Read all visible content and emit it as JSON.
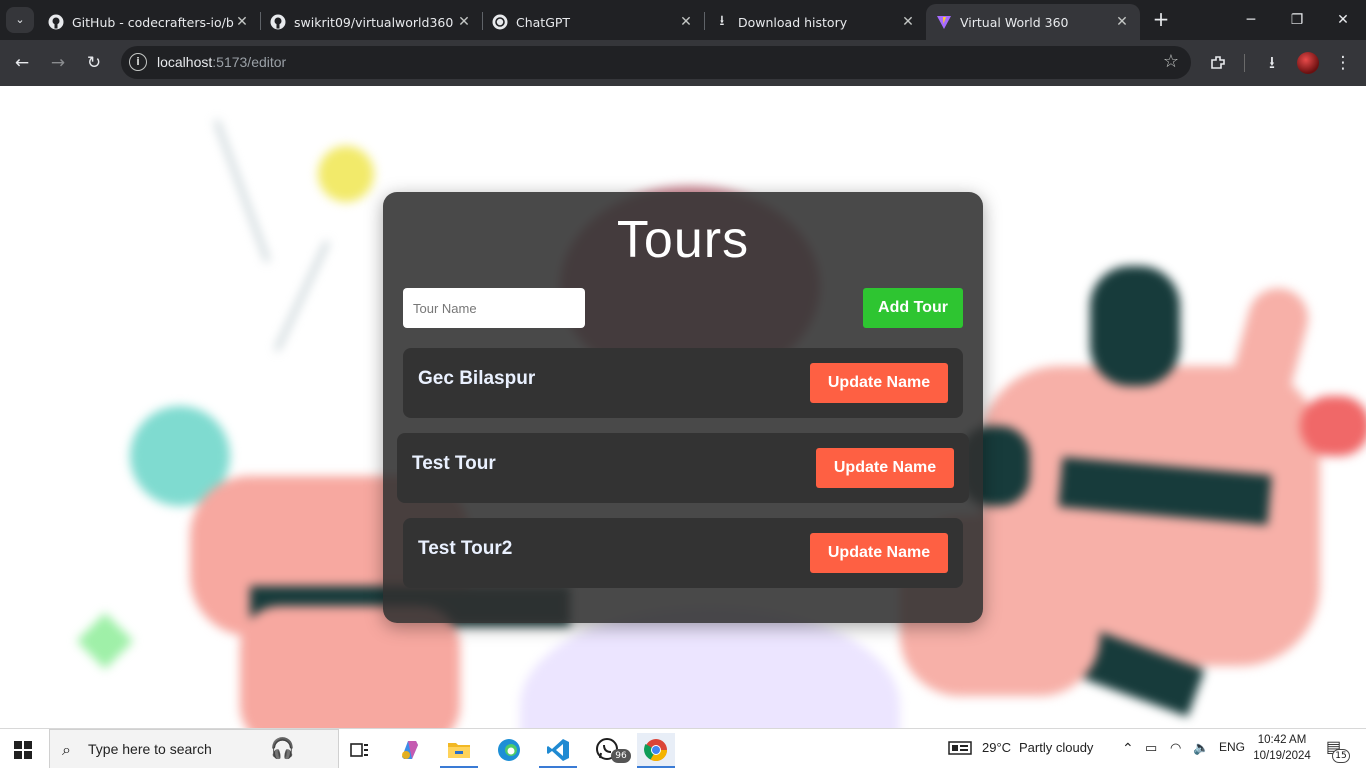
{
  "browser": {
    "tabs": [
      {
        "title": "GitHub - codecrafters-io/bui",
        "icon": "github-icon"
      },
      {
        "title": "swikrit09/virtualworld360",
        "icon": "github-icon"
      },
      {
        "title": "ChatGPT",
        "icon": "chatgpt-icon"
      },
      {
        "title": "Download history",
        "icon": "download-icon"
      },
      {
        "title": "Virtual World 360",
        "icon": "vite-icon",
        "active": true
      }
    ],
    "url_host": "localhost",
    "url_path": ":5173/editor"
  },
  "editor": {
    "title": "Tours",
    "input_placeholder": "Tour Name",
    "add_button": "Add Tour",
    "update_button": "Update Name",
    "tours": [
      "Gec Bilaspur",
      "Test Tour",
      "Test Tour2"
    ]
  },
  "taskbar": {
    "search_placeholder": "Type here to search",
    "whatsapp_badge": "96",
    "weather_temp": "29°C",
    "weather_desc": "Partly cloudy",
    "language": "ENG",
    "time": "10:42 AM",
    "date": "10/19/2024",
    "notification_count": "15"
  },
  "colors": {
    "add_button": "#2ec531",
    "update_button": "#fe6043",
    "panel": "#303030"
  }
}
